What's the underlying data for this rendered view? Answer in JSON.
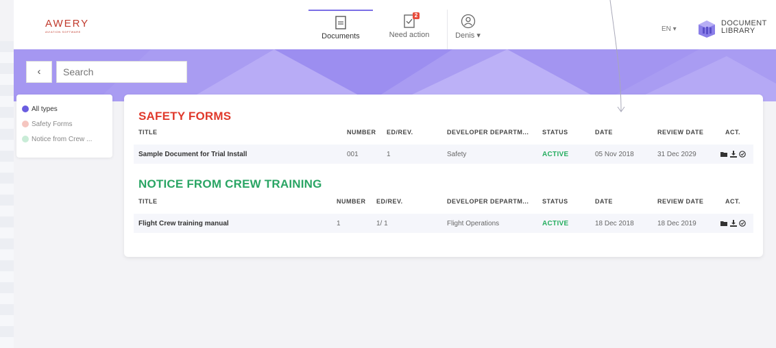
{
  "header": {
    "logo_main": "AWERY",
    "logo_sub": "AVIATION SOFTWARE",
    "nav": {
      "documents": "Documents",
      "need_action": "Need action",
      "need_action_count": "2",
      "user": "Denis"
    },
    "lang": "EN",
    "doc_library_line1": "DOCUMENT",
    "doc_library_line2": "LIBRARY"
  },
  "search": {
    "value": "Search"
  },
  "filters": [
    {
      "label": "All types",
      "color": "#6a5de0",
      "active": true
    },
    {
      "label": "Safety Forms",
      "color": "#f5c6c0",
      "active": false
    },
    {
      "label": "Notice from Crew ...",
      "color": "#c9ecd7",
      "active": false
    }
  ],
  "columns": {
    "title": "TITLE",
    "number": "NUMBER",
    "edrev": "ED/REV.",
    "dept": "DEVELOPER DEPARTM...",
    "status": "STATUS",
    "date": "DATE",
    "review": "REVIEW DATE",
    "act": "ACT."
  },
  "sections": [
    {
      "title": "SAFETY FORMS",
      "color": "#e0392b",
      "row": {
        "title": "Sample Document for Trial Install",
        "number": "001",
        "edrev": "1",
        "dept": "Safety",
        "status": "ACTIVE",
        "date": "05 Nov 2018",
        "review": "31 Dec 2029"
      }
    },
    {
      "title": "NOTICE FROM CREW TRAINING",
      "color": "#2aa564",
      "row": {
        "title": "Flight Crew training manual",
        "number": "1",
        "edrev": "1/ 1",
        "dept": "Flight Operations",
        "status": "ACTIVE",
        "date": "18 Dec 2018",
        "review": "18 Dec 2019"
      }
    }
  ],
  "icons": [
    "folder-icon",
    "download-icon",
    "check-circle-icon"
  ]
}
